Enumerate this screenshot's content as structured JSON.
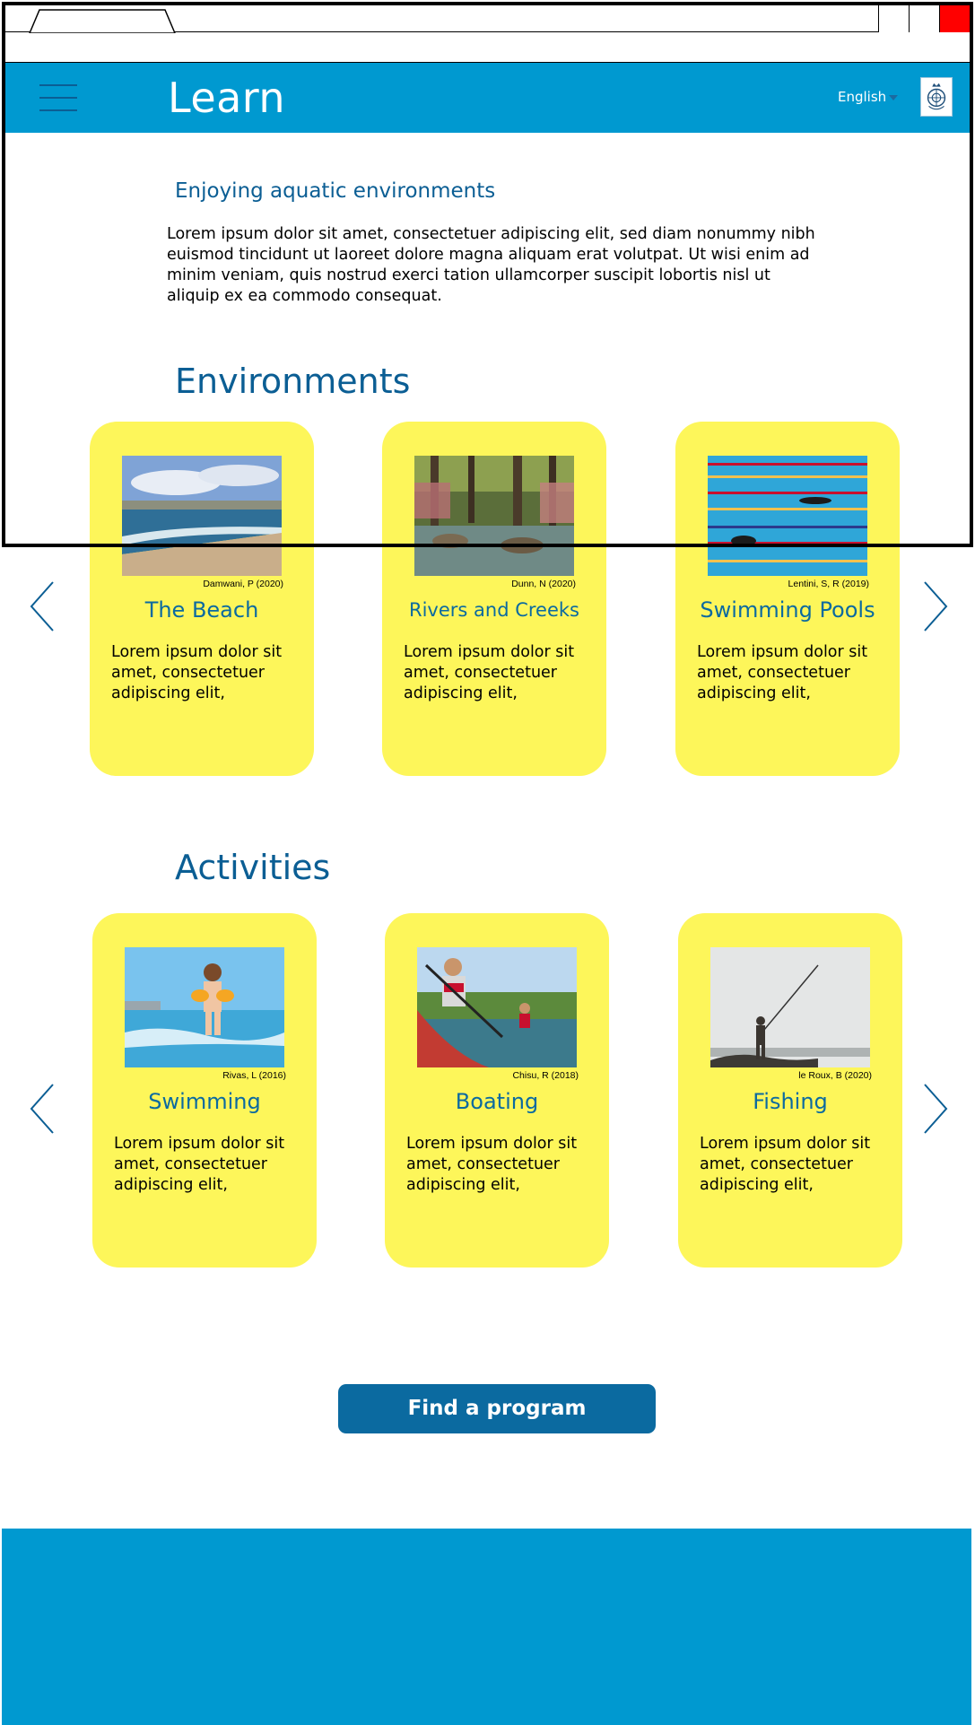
{
  "header": {
    "title": "Learn",
    "language": "English"
  },
  "intro": {
    "heading": "Enjoying aquatic environments",
    "text": "Lorem ipsum dolor sit amet, consectetuer adipiscing elit, sed diam nonummy nibh euismod tincidunt ut laoreet dolore magna aliquam erat volutpat. Ut wisi enim ad minim veniam, quis nostrud exerci tation ullamcorper suscipit lobortis nisl ut aliquip ex ea commodo consequat."
  },
  "environments": {
    "heading": "Environments",
    "cards": [
      {
        "title": "The Beach",
        "credit": "Damwani, P (2020)",
        "text": "Lorem ipsum dolor sit amet, consectetuer adipiscing elit,",
        "image_icon": "beach-photo"
      },
      {
        "title": "Rivers and Creeks",
        "credit": "Dunn, N (2020)",
        "text": "Lorem ipsum dolor sit amet, consectetuer adipiscing elit,",
        "image_icon": "creek-photo"
      },
      {
        "title": "Swimming Pools",
        "credit": "Lentini, S, R (2019)",
        "text": "Lorem ipsum dolor sit amet, consectetuer adipiscing elit,",
        "image_icon": "pool-photo"
      }
    ]
  },
  "activities": {
    "heading": "Activities",
    "cards": [
      {
        "title": "Swimming",
        "credit": "Rivas, L (2016)",
        "text": "Lorem ipsum dolor sit amet, consectetuer adipiscing elit,",
        "image_icon": "child-swimming-photo"
      },
      {
        "title": "Boating",
        "credit": "Chisu, R (2018)",
        "text": "Lorem ipsum dolor sit amet, consectetuer adipiscing elit,",
        "image_icon": "kayak-photo"
      },
      {
        "title": "Fishing",
        "credit": "le Roux, B (2020)",
        "text": "Lorem ipsum dolor sit amet, consectetuer adipiscing elit,",
        "image_icon": "fishing-photo"
      }
    ]
  },
  "cta": {
    "label": "Find a program"
  },
  "colors": {
    "header_blue": "#0099d0",
    "heading_blue": "#0b5e94",
    "card_yellow": "#fdf65a",
    "button_blue": "#0b6aa0",
    "close_red": "#ff0000"
  }
}
